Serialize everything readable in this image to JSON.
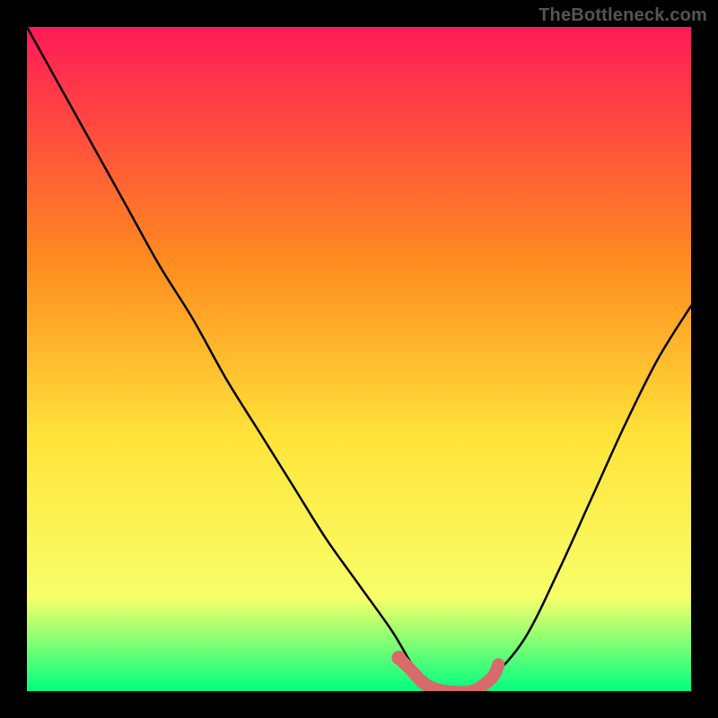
{
  "watermark": "TheBottleneck.com",
  "colors": {
    "page_bg": "#000000",
    "gradient_top": "#ff1a58",
    "gradient_mid1": "#ff8a1f",
    "gradient_mid2": "#ffe43a",
    "gradient_mid3": "#f7ff6a",
    "gradient_bottom": "#00ff80",
    "curve": "#000000",
    "highlight": "#d86a6a"
  },
  "chart_data": {
    "type": "line",
    "title": "",
    "xlabel": "",
    "ylabel": "",
    "xlim": [
      0,
      100
    ],
    "ylim": [
      0,
      100
    ],
    "grid": false,
    "series": [
      {
        "name": "bottleneck_curve",
        "x": [
          0,
          5,
          10,
          15,
          20,
          25,
          30,
          35,
          40,
          45,
          50,
          55,
          58,
          60,
          63,
          67,
          70,
          75,
          80,
          85,
          90,
          95,
          100
        ],
        "y": [
          100,
          91,
          82,
          73,
          64,
          56,
          47,
          39,
          31,
          23,
          16,
          9,
          4,
          2,
          0,
          0,
          2,
          8,
          18,
          29,
          40,
          50,
          58
        ]
      },
      {
        "name": "optimal_range_highlight",
        "x": [
          56,
          58,
          60,
          63,
          67,
          70,
          71
        ],
        "y": [
          5,
          3,
          1,
          0,
          0,
          2,
          4
        ]
      }
    ],
    "legend": false,
    "notes": "Curve shows bottleneck percentage vs. component balance; highlighted pink segment marks the low-bottleneck optimal zone around x≈56–71."
  }
}
